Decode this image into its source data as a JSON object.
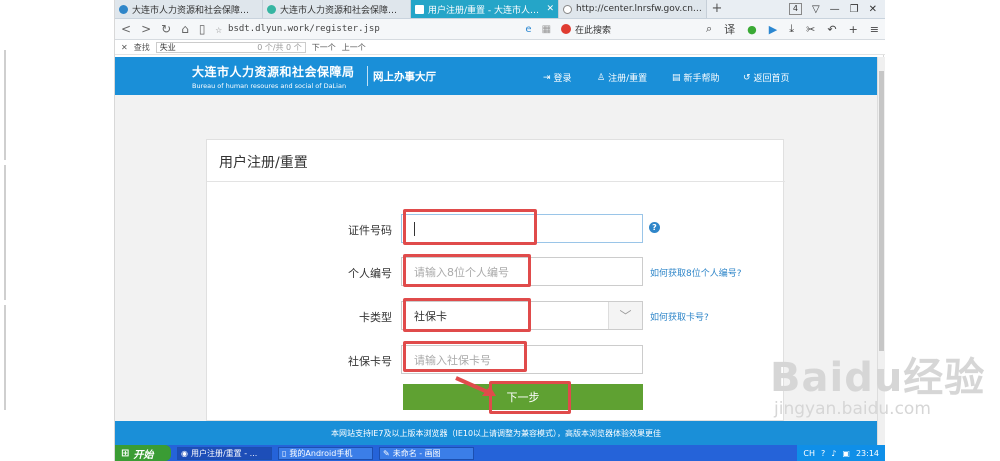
{
  "tabs": [
    {
      "label": "大连市人力资源和社会保障局_百度搜",
      "icon_color": "#2f86c9",
      "active": false
    },
    {
      "label": "大连市人力资源和社会保障局 - 网上",
      "icon_color": "#36b5a2",
      "active": false
    },
    {
      "label": "用户注册/重置 - 大连市人力资源和",
      "icon_color": "#ffffff",
      "active": true
    },
    {
      "label": "http://center.lnrsfw.gov.cn/api/v",
      "icon_color": "#888888",
      "active": false
    }
  ],
  "tab_new": "+",
  "window": {
    "tab_count": "4",
    "minimize": "—",
    "maximize": "❐",
    "close": "✕"
  },
  "address": {
    "url": "bsdt.dlyun.work/register.jsp",
    "search_engine_label": "在此搜索"
  },
  "toolbar": {
    "translate": "译",
    "back": "<",
    "forward": ">",
    "reload": "C",
    "home": "⌂"
  },
  "findbar": {
    "label": "查找",
    "query": "失业",
    "count": "0 个/共 0 个",
    "next": "下一个",
    "prev": "上一个",
    "close": "✕"
  },
  "site": {
    "title_cn": "大连市人力资源和社会保障局",
    "title_en": "Bureau of human resoures and social of DaLian",
    "section": "网上办事大厅",
    "nav": {
      "login": "登录",
      "register": "注册/重置",
      "help": "新手帮助",
      "home": "返回首页"
    }
  },
  "form": {
    "title": "用户注册/重置",
    "fields": [
      {
        "label": "证件号码",
        "value": "",
        "placeholder": ""
      },
      {
        "label": "个人编号",
        "value": "",
        "placeholder": "请输入8位个人编号",
        "help": "如何获取8位个人编号?"
      },
      {
        "label": "卡类型",
        "value": "社保卡",
        "placeholder": "",
        "help": "如何获取卡号?"
      },
      {
        "label": "社保卡号",
        "value": "",
        "placeholder": "请输入社保卡号"
      }
    ],
    "next_button": "下一步"
  },
  "footer": "本网站支持IE7及以上版本浏览器（IE10以上请调整为兼容模式），高版本浏览器体验效果更佳",
  "taskbar": {
    "start": "开始",
    "items": [
      "用户注册/重置 - ...",
      "我的Android手机",
      "未命名 - 画图"
    ],
    "tray": {
      "ime": "CH",
      "time": "23:14"
    }
  },
  "watermark": {
    "logo": "Baidu经验",
    "url": "jingyan.baidu.com"
  },
  "colors": {
    "header_blue": "#1a8fd8",
    "next_green": "#5fa132",
    "highlight_red": "#e04b4b",
    "active_tab": "#25a5c8"
  }
}
